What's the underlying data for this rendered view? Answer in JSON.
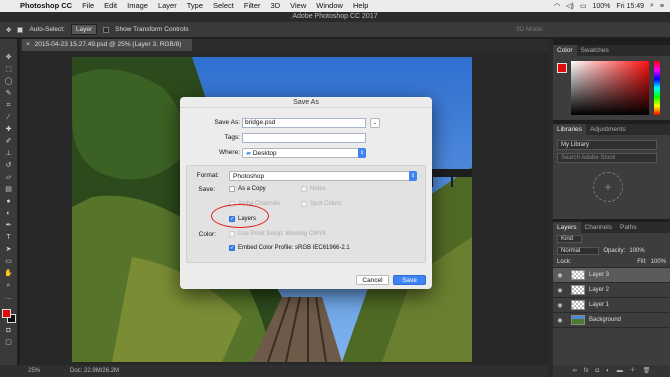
{
  "menubar": {
    "app_name": "Photoshop CC",
    "items": [
      "File",
      "Edit",
      "Image",
      "Layer",
      "Type",
      "Select",
      "Filter",
      "3D",
      "View",
      "Window",
      "Help"
    ],
    "battery": "100%",
    "clock": "Fri 15:49"
  },
  "window": {
    "title": "Adobe Photoshop CC 2017"
  },
  "options_bar": {
    "auto_select_label": "Auto-Select:",
    "auto_select_value": "Layer",
    "transform_label": "Show Transform Controls",
    "mode_3d_label": "3D Mode:"
  },
  "document": {
    "tab_title": "2015-04-23 15.27.49.psd @ 25% (Layer 3, RGB/8)",
    "zoom": "25%",
    "doc_size": "Doc: 22.9M/26.2M"
  },
  "panels": {
    "color_tabs": [
      "Color",
      "Swatches"
    ],
    "libraries_tabs": [
      "Libraries",
      "Adjustments"
    ],
    "library_select": "My Library",
    "library_search_placeholder": "Search Adobe Stock",
    "layers_tabs": [
      "Layers",
      "Channels",
      "Paths"
    ],
    "kind_filter": "Kind",
    "blend_mode": "Normal",
    "opacity_label": "Opacity:",
    "opacity_value": "100%",
    "lock_label": "Lock:",
    "fill_label": "Fill:",
    "fill_value": "100%",
    "layers": [
      {
        "name": "Layer 3",
        "selected": true,
        "background": false
      },
      {
        "name": "Layer 2",
        "selected": false,
        "background": false
      },
      {
        "name": "Layer 1",
        "selected": false,
        "background": false
      },
      {
        "name": "Background",
        "selected": false,
        "background": true
      }
    ]
  },
  "dialog": {
    "title": "Save As",
    "save_as_label": "Save As:",
    "save_as_value": "bridge.psd",
    "tags_label": "Tags:",
    "where_label": "Where:",
    "where_value": "Desktop",
    "format_label": "Format:",
    "format_value": "Photoshop",
    "save_label": "Save:",
    "as_copy_label": "As a Copy",
    "notes_label": "Notes",
    "alpha_label": "Alpha Channels",
    "spot_label": "Spot Colors",
    "layers_label": "Layers",
    "color_label": "Color:",
    "proof_label": "Use Proof Setup: Working CMYK",
    "embed_label": "Embed Color Profile:  sRGB IEC61966-2.1",
    "cancel_label": "Cancel",
    "save_button_label": "Save"
  },
  "colors": {
    "foreground": "#e20b0b",
    "accent": "#3f84f5",
    "annotation": "#e02020"
  }
}
